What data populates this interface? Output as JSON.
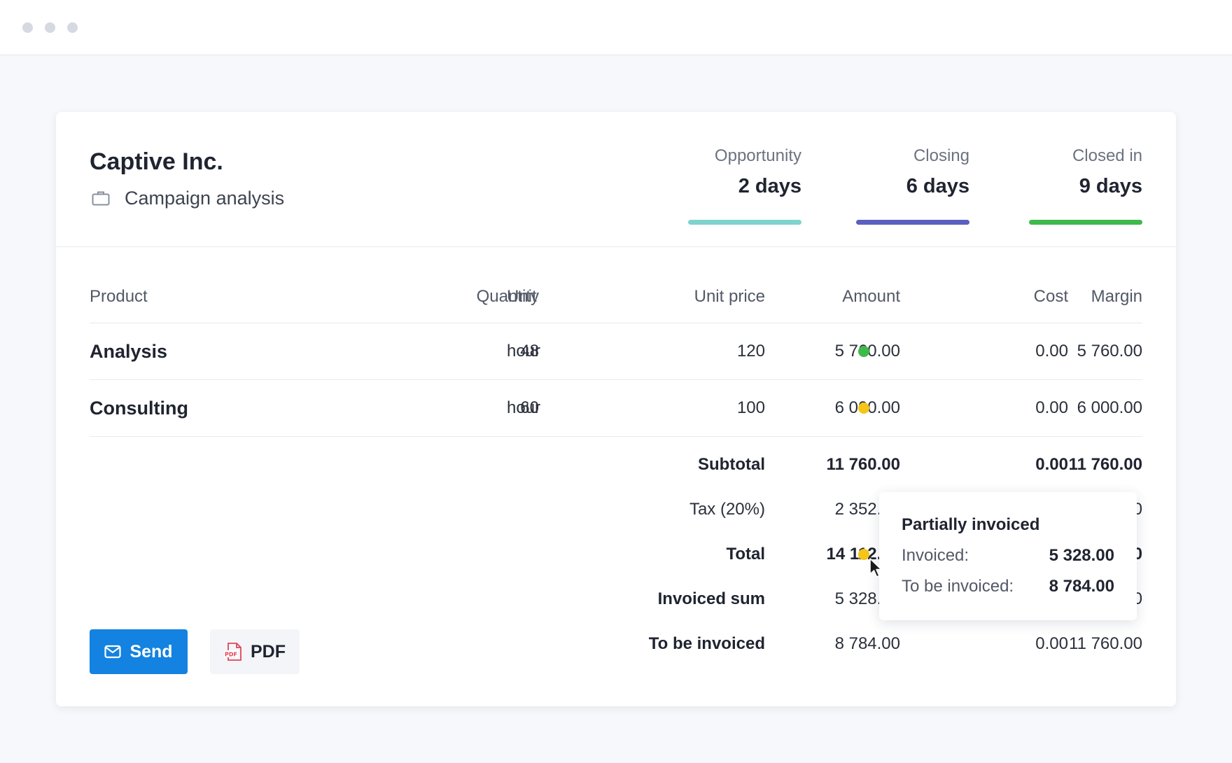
{
  "window": {
    "controls": [
      "close",
      "minimize",
      "maximize"
    ]
  },
  "deal": {
    "company": "Captive Inc.",
    "project": "Campaign analysis",
    "project_icon": "briefcase-icon"
  },
  "stages": [
    {
      "label": "Opportunity",
      "value": "2 days",
      "color": "#7fd3cc"
    },
    {
      "label": "Closing",
      "value": "6 days",
      "color": "#5a5fc0"
    },
    {
      "label": "Closed in",
      "value": "9 days",
      "color": "#3fb94b"
    }
  ],
  "table": {
    "headers": {
      "product": "Product",
      "quantity": "Quantity",
      "unit": "Unit",
      "unit_price": "Unit price",
      "amount": "Amount",
      "cost": "Cost",
      "margin": "Margin"
    },
    "rows": [
      {
        "product": "Analysis",
        "quantity": "48",
        "unit": "hour",
        "unit_price": "120",
        "amount": "5 760.00",
        "status_color": "#3fb94b",
        "cost": "0.00",
        "margin": "5 760.00"
      },
      {
        "product": "Consulting",
        "quantity": "60",
        "unit": "hour",
        "unit_price": "100",
        "amount": "6 000.00",
        "status_color": "#f5c518",
        "cost": "0.00",
        "margin": "6 000.00"
      }
    ]
  },
  "summary": {
    "subtotal": {
      "label": "Subtotal",
      "amount": "11 760.00",
      "cost": "0.00",
      "margin": "11 760.00"
    },
    "tax": {
      "label": "Tax (20%)",
      "amount": "2 352.00",
      "margin_partial": "0"
    },
    "total": {
      "label": "Total",
      "amount": "14 112.00",
      "status_color": "#f5c518",
      "margin_partial": "0"
    },
    "invoiced_sum": {
      "label": "Invoiced sum",
      "amount": "5 328.00",
      "margin_partial": "0"
    },
    "to_be_invoiced": {
      "label": "To be invoiced",
      "amount": "8 784.00",
      "cost": "0.00",
      "margin": "11 760.00"
    }
  },
  "tooltip": {
    "title": "Partially invoiced",
    "invoiced_label": "Invoiced:",
    "invoiced_value": "5 328.00",
    "to_be_invoiced_label": "To be invoiced:",
    "to_be_invoiced_value": "8 784.00"
  },
  "actions": {
    "send_label": "Send",
    "send_icon": "mail-icon",
    "pdf_label": "PDF",
    "pdf_icon": "pdf-file-icon"
  },
  "colors": {
    "accent": "#1382e0"
  }
}
